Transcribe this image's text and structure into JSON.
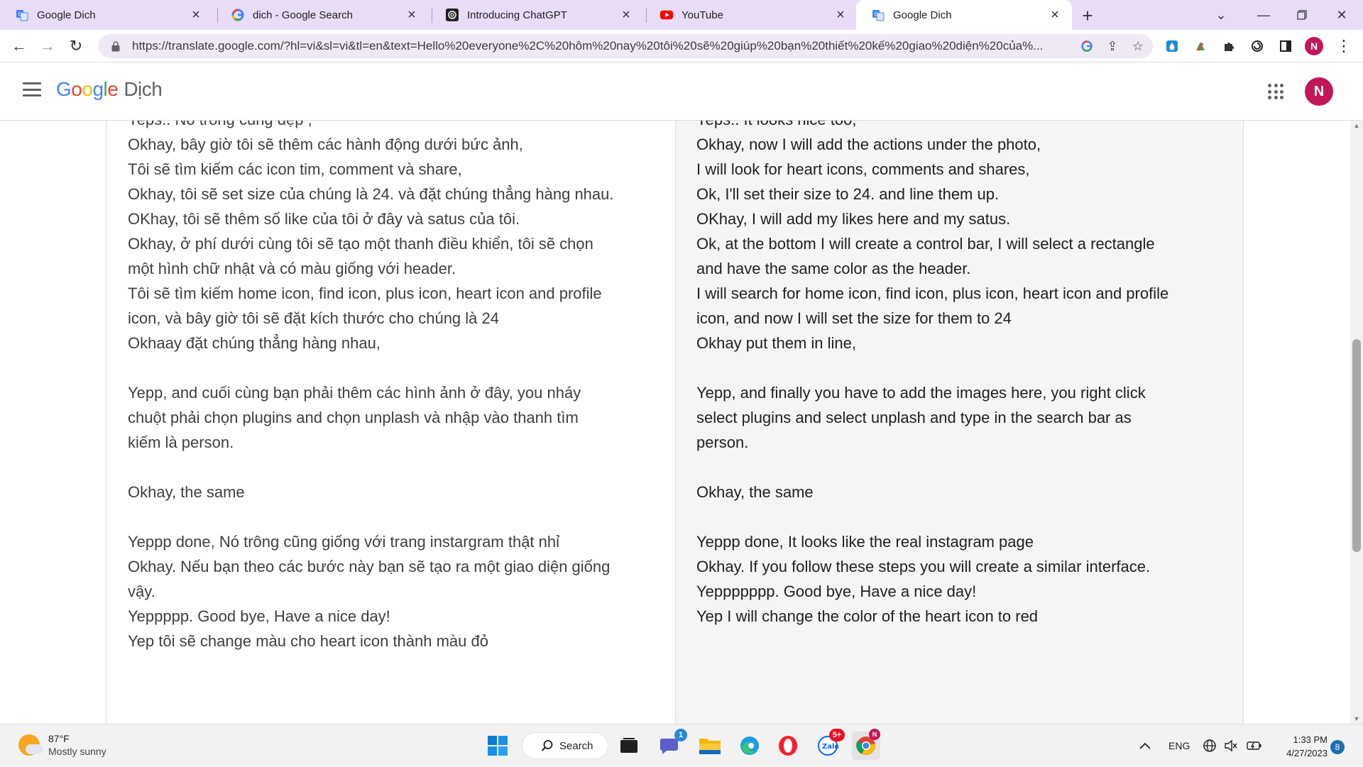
{
  "tabs": [
    {
      "title": "Google Dich",
      "icon": "google-translate-icon"
    },
    {
      "title": "dich - Google Search",
      "icon": "google-icon"
    },
    {
      "title": "Introducing ChatGPT",
      "icon": "openai-icon"
    },
    {
      "title": "YouTube",
      "icon": "youtube-icon"
    },
    {
      "title": "Google Dich",
      "icon": "google-translate-icon",
      "active": true
    }
  ],
  "address_bar": {
    "url": "https://translate.google.com/?hl=vi&sl=vi&tl=en&text=Hello%20everyone%2C%20hôm%20nay%20tôi%20sẽ%20giúp%20bạn%20thiết%20kế%20giao%20diện%20của%..."
  },
  "profile_initial": "N",
  "app": {
    "logo_letters": [
      "G",
      "o",
      "o",
      "g",
      "l",
      "e"
    ],
    "product": "Dịch",
    "avatar_initial": "N"
  },
  "source_lines": [
    "Yeps.. Nó trông cũng đẹp ,",
    "Okhay, bây giờ tôi sẽ thêm các hành động dưới bức ảnh,",
    "Tôi sẽ tìm kiếm các icon tim, comment và share,",
    "Okhay, tôi sẽ set size của chúng là 24. và đặt chúng thẳng hàng nhau.",
    "OKhay, tôi sẽ thêm số like của tôi ở đây và satus của tôi.",
    "Okhay, ở phí dưới cùng tôi sẽ tạo một thanh điều khiển, tôi sẽ chọn",
    "một hình chữ nhật và có màu giống với header.",
    "Tôi sẽ tìm kiếm home icon, find icon, plus icon, heart icon and profile",
    "icon, và bây giờ tôi sẽ đặt  kích thước cho chúng là 24",
    "Okhaay đặt chúng thẳng hàng nhau,",
    "",
    "Yepp, and  cuối cùng bạn phải thêm các hình ảnh ở đây, you nháy",
    "chuột phải chọn plugins and chọn unplash và nhập vào thanh tìm",
    "kiếm là person.",
    "",
    "Okhay, the same",
    "",
    "Yeppp done, Nó trông cũng giống với trang instargram thật nhỉ",
    "Okhay. Nếu bạn theo các bước này bạn sẽ tạo ra một giao diện giống",
    "vậy.",
    "Yeppppp. Good bye, Have a nice day!",
    "Yep tôi sẽ change màu cho heart icon thành màu đỏ"
  ],
  "translation_lines": [
    "Yeps.. It looks nice too,",
    "Okhay, now I will add the actions under the photo,",
    "I will look for heart icons, comments and shares,",
    "Ok, I'll set their size to 24. and line them up.",
    "OKhay, I will add my likes here and my satus.",
    "Ok, at the bottom I will create a control bar, I will select a rectangle",
    "and have the same color as the header.",
    "I will search for home icon, find icon, plus icon, heart icon and profile",
    "icon, and now I will set the size for them to 24",
    "Okhay put them in line,",
    "",
    "Yepp, and finally you have to add the images here, you right click",
    "select plugins and select unplash and type in the search bar as",
    "person.",
    "",
    "Okhay, the same",
    "",
    "Yeppp done, It looks like the real instagram page",
    "Okhay. If you follow these steps you will create a similar interface.",
    "Yeppppppp. Good bye, Have a nice day!",
    "Yep I will change the color of the heart icon to red"
  ],
  "taskbar": {
    "weather_temp": "87°F",
    "weather_desc": "Mostly sunny",
    "search_label": "Search",
    "teams_badge": "1",
    "zalo_badge": "5+",
    "chrome_badge": "N",
    "language": "ENG",
    "time": "1:33 PM",
    "date": "4/27/2023",
    "notification_count": "8"
  },
  "colors": {
    "tabstrip_bg": "#e8dcf7",
    "accent_profile": "#c2185b",
    "translation_panel_bg": "#f5f5f5"
  }
}
